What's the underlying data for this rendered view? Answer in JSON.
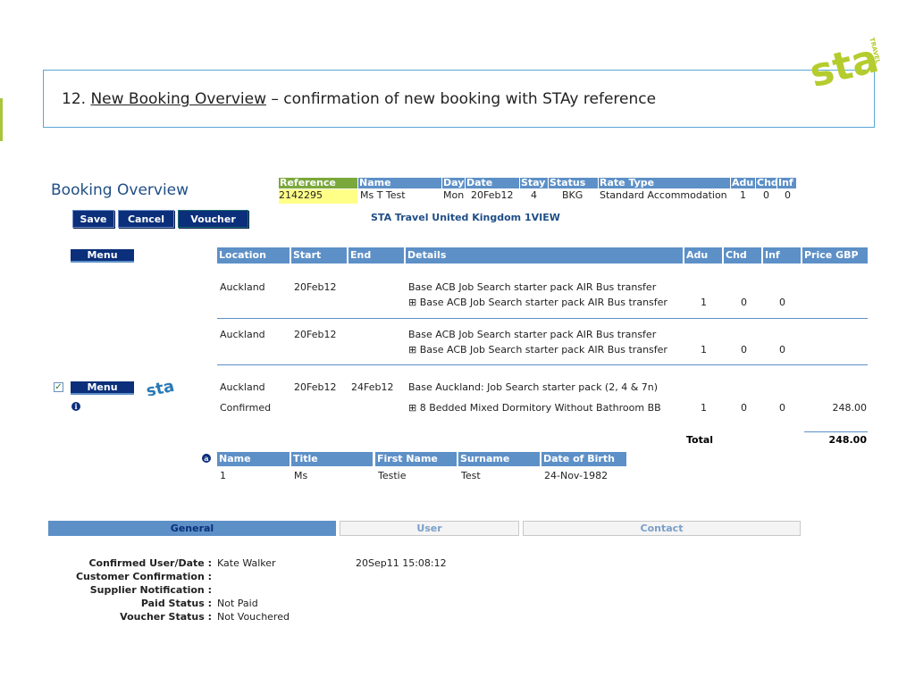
{
  "slide": {
    "title_prefix": "12. ",
    "title_link": "New Booking Overview",
    "title_suffix": " – confirmation of new booking with STAy reference",
    "logo_text": "sta",
    "logo_sub": "TRAVEL"
  },
  "booking": {
    "title": "Booking Overview",
    "buttons": {
      "save": "Save",
      "cancel": "Cancel",
      "voucher": "Voucher"
    },
    "summary": {
      "headers": [
        "Reference",
        "Name",
        "Day",
        "Date",
        "Stay",
        "Status",
        "Rate Type",
        "Adu",
        "Chd",
        "Inf"
      ],
      "values": [
        "2142295",
        "Ms T Test",
        "Mon",
        "20Feb12",
        "4",
        "BKG",
        "Standard Accommodation",
        "1",
        "0",
        "0"
      ]
    },
    "agency": "STA Travel United Kingdom 1VIEW",
    "menu_label": "Menu",
    "grid_headers": [
      "Location",
      "Start",
      "End",
      "Details",
      "Adu",
      "Chd",
      "Inf",
      "Price GBP"
    ],
    "rows": [
      {
        "location": "Auckland",
        "start": "20Feb12",
        "end": "",
        "detail_line1": "Base ACB Job Search starter pack AIR Bus transfer",
        "detail_line2": "⊞ Base ACB Job Search starter pack AIR Bus transfer",
        "adu": "1",
        "chd": "0",
        "inf": "0",
        "price": ""
      },
      {
        "location": "Auckland",
        "start": "20Feb12",
        "end": "",
        "detail_line1": "Base ACB Job Search starter pack AIR Bus transfer",
        "detail_line2": "⊞ Base ACB Job Search starter pack AIR Bus transfer",
        "adu": "1",
        "chd": "0",
        "inf": "0",
        "price": ""
      },
      {
        "location": "Auckland",
        "status": "Confirmed",
        "start": "20Feb12",
        "end": "24Feb12",
        "detail_line1": "Base Auckland: Job Search starter pack (2, 4 & 7n)",
        "detail_line2": "⊞ 8 Bedded Mixed Dormitory Without Bathroom BB",
        "adu": "1",
        "chd": "0",
        "inf": "0",
        "price": "248.00"
      }
    ],
    "total_label": "Total",
    "total_value": "248.00",
    "pax_headers": [
      "Name",
      "Title",
      "First Name",
      "Surname",
      "Date of Birth"
    ],
    "pax": [
      "1",
      "Ms",
      "Testie",
      "Test",
      "24-Nov-1982"
    ],
    "tabs": [
      "General",
      "User",
      "Contact"
    ],
    "general": {
      "confirmed_label": "Confirmed User/Date :",
      "confirmed_user": "Kate Walker",
      "confirmed_date": "20Sep11 15:08:12",
      "customer_conf_label": "Customer Confirmation :",
      "supplier_label": "Supplier Notification :",
      "paid_label": "Paid Status :",
      "paid_value": "Not Paid",
      "voucher_label": "Voucher Status :",
      "voucher_value": "Not Vouchered"
    }
  },
  "colors": {
    "accent": "#a8c53a",
    "header_blue": "#5d90c7",
    "nav_navy": "#0b2f7a",
    "highlight_yellow": "#ffff88"
  }
}
